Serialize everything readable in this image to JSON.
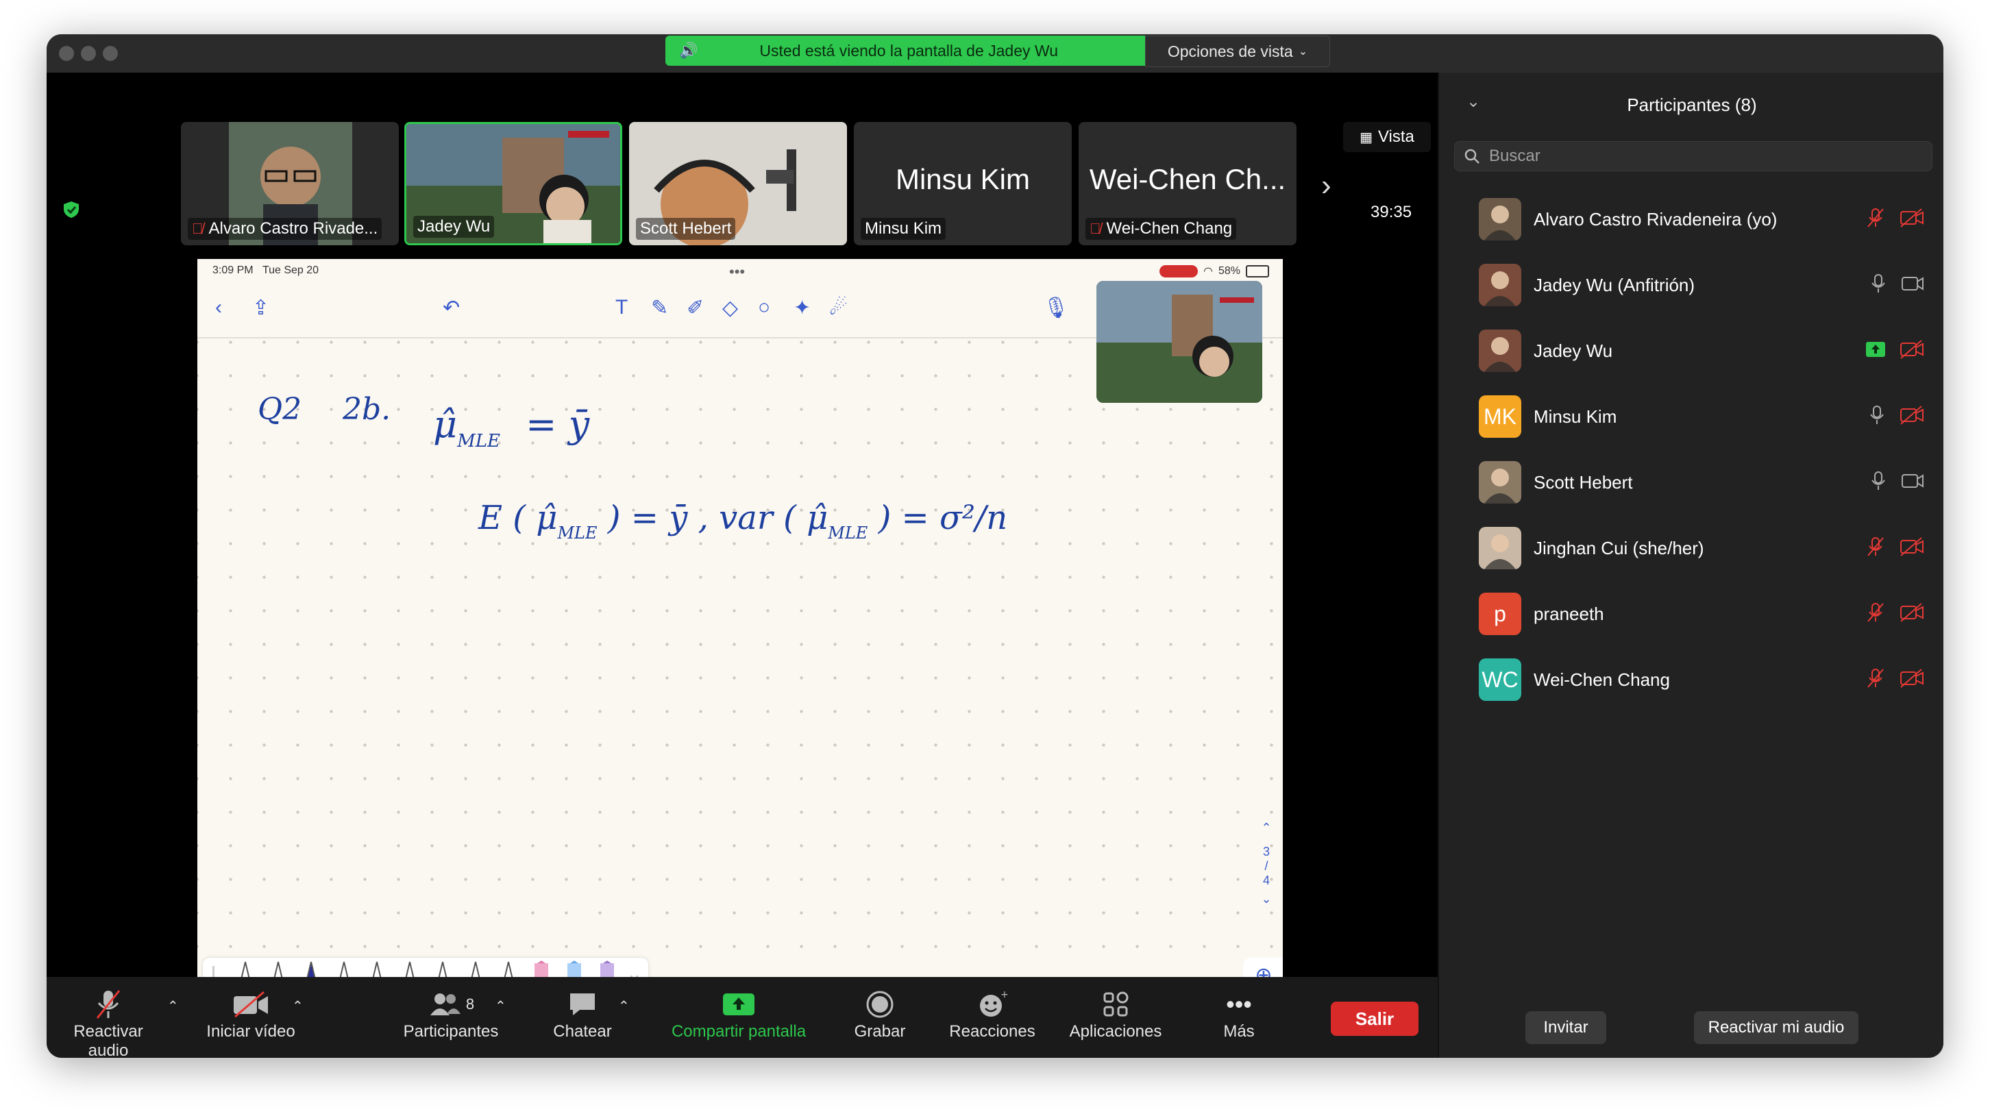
{
  "banner": {
    "text": "Usted está viendo la pantalla de Jadey Wu",
    "options": "Opciones de vista"
  },
  "thumbnails": [
    {
      "name": "Alvaro Castro Rivade...",
      "muted": true
    },
    {
      "name": "Jadey Wu",
      "muted": false,
      "active": true
    },
    {
      "name": "Scott Hebert",
      "muted": false
    },
    {
      "name": "Minsu Kim",
      "big": "Minsu Kim",
      "muted": false
    },
    {
      "name": "Wei-Chen Chang",
      "big": "Wei-Chen Ch...",
      "muted": true
    }
  ],
  "vista_label": "Vista",
  "timer": "39:35",
  "ipad": {
    "time": "3:09 PM",
    "date": "Tue Sep 20",
    "battery": "58%",
    "page_top": "3",
    "page_bottom": "4"
  },
  "notes": {
    "line1_label": "Q2",
    "line1_sub": "2b.",
    "eq1_left": "μ̂",
    "eq1_sub": "MLE",
    "eq1_right": "= ȳ",
    "eq2_a": "E ( μ̂",
    "eq2_a_sub": "MLE",
    "eq2_b": ") = ȳ",
    "eq2_c": ",  var ( μ̂",
    "eq2_c_sub": "MLE",
    "eq2_d": ") = σ²/n"
  },
  "bottom_bar": {
    "audio": "Reactivar audio",
    "video": "Iniciar vídeo",
    "participants": "Participantes",
    "participants_count": "8",
    "chat": "Chatear",
    "share": "Compartir pantalla",
    "record": "Grabar",
    "reactions": "Reacciones",
    "apps": "Aplicaciones",
    "more": "Más",
    "leave": "Salir"
  },
  "panel": {
    "title": "Participantes (8)",
    "search_placeholder": "Buscar",
    "participants": [
      {
        "name": "Alvaro Castro Rivadeneira (yo)",
        "initials": "",
        "color": "#6b5a48",
        "mic": "off",
        "cam": "off"
      },
      {
        "name": "Jadey Wu (Anfitrión)",
        "initials": "",
        "color": "#7a4b3a",
        "mic": "on",
        "cam": "on"
      },
      {
        "name": "Jadey Wu",
        "initials": "",
        "color": "#7a4b3a",
        "mic": "share",
        "cam": "off"
      },
      {
        "name": "Minsu Kim",
        "initials": "MK",
        "color": "#f5a623",
        "mic": "on",
        "cam": "off"
      },
      {
        "name": "Scott Hebert",
        "initials": "",
        "color": "#8a7a64",
        "mic": "on",
        "cam": "on"
      },
      {
        "name": "Jinghan Cui (she/her)",
        "initials": "",
        "color": "#c9b8a6",
        "mic": "off",
        "cam": "off"
      },
      {
        "name": "praneeth",
        "initials": "p",
        "color": "#e0492f",
        "mic": "off",
        "cam": "off"
      },
      {
        "name": "Wei-Chen Chang",
        "initials": "WC",
        "color": "#2bb5a0",
        "mic": "off",
        "cam": "off"
      }
    ],
    "invite": "Invitar",
    "unmute_me": "Reactivar mi audio"
  },
  "colors": {
    "accent_green": "#2dc84d",
    "leave_red": "#d92a2a",
    "ink": "#1d3f9e"
  }
}
